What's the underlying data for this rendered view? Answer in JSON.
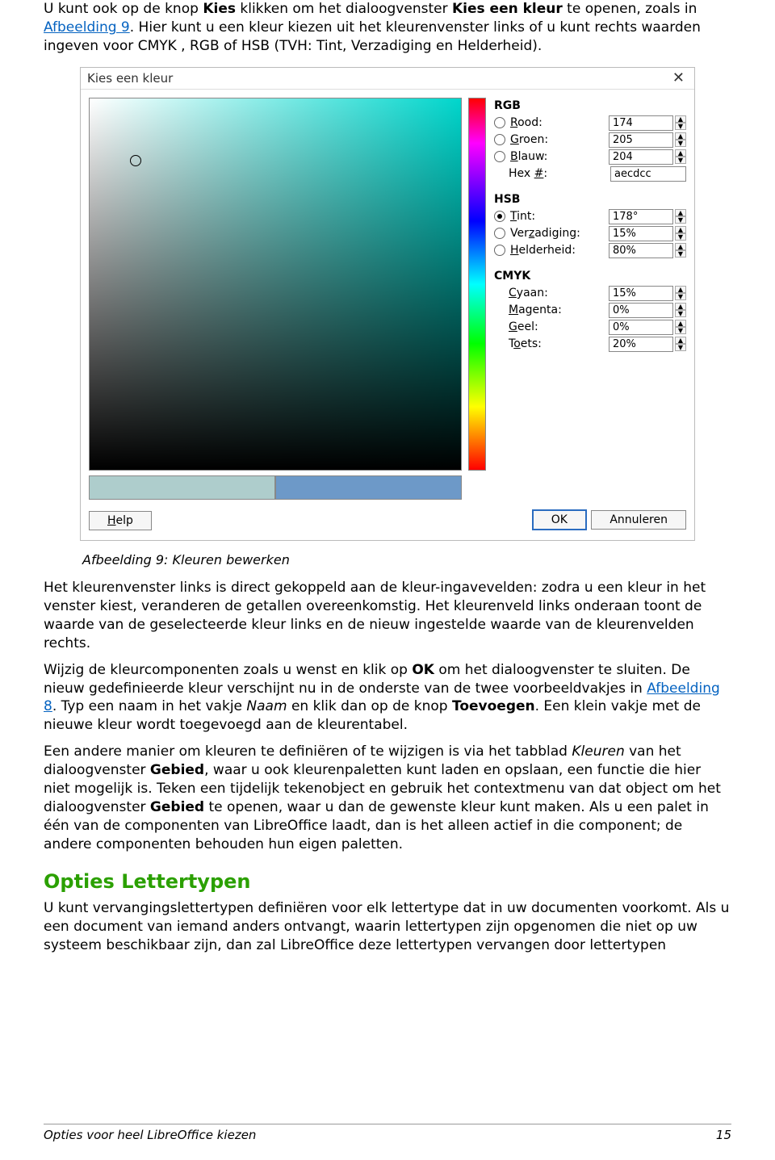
{
  "intro": {
    "t1a": "U kunt ook op de knop ",
    "t1b": "Kies",
    "t1c": " klikken om het dialoogvenster ",
    "t1d": "Kies een kleur",
    "t1e": " te openen, zoals in ",
    "link1": "Afbeelding 9",
    "t2": ". Hier kunt u een kleur kiezen uit het kleurenvenster links of u kunt rechts waarden ingeven voor CMYK , RGB of HSB (TVH: Tint, Verzadiging en Helderheid)."
  },
  "dialog": {
    "title": "Kies een kleur",
    "rgb_head": "RGB",
    "rood_u": "R",
    "rood_rest": "ood:",
    "rood_val": "174",
    "groen_u": "G",
    "groen_rest": "roen:",
    "groen_val": "205",
    "blauw_u": "B",
    "blauw_rest": "lauw:",
    "blauw_val": "204",
    "hex_label": "Hex ",
    "hex_u": "#",
    "hex_colon": ":",
    "hex_val": "aecdcc",
    "hsb_head": "HSB",
    "tint_u": "T",
    "tint_rest": "int:",
    "tint_val": "178°",
    "verz_pre": "Ver",
    "verz_u": "z",
    "verz_post": "adiging:",
    "verz_val": "15%",
    "held_u": "H",
    "held_rest": "elderheid:",
    "held_val": "80%",
    "cmyk_head": "CMYK",
    "cyaan_u": "C",
    "cyaan_rest": "yaan:",
    "cyaan_val": "15%",
    "mag_u": "M",
    "mag_rest": "agenta:",
    "mag_val": "0%",
    "geel_u": "G",
    "geel_rest": "eel:",
    "geel_val": "0%",
    "toets_pre": "T",
    "toets_u": "o",
    "toets_post": "ets:",
    "toets_val": "20%",
    "help_u": "H",
    "help_rest": "elp",
    "ok": "OK",
    "cancel": "Annuleren"
  },
  "caption": "Afbeelding 9: Kleuren bewerken",
  "p1": "Het  kleurenvenster links is direct gekoppeld aan de kleur-ingavevelden: zodra u een kleur in het venster kiest, veranderen de getallen overeenkomstig. Het kleurenveld links onderaan toont de waarde van de geselecteerde kleur links en de nieuw ingestelde waarde van de kleurenvelden rechts.",
  "p2a": "Wijzig de kleurcomponenten zoals u wenst en klik op ",
  "p2b": "OK",
  "p2c": " om het dialoogvenster te sluiten. De nieuw gedefinieerde kleur verschijnt nu in de onderste van de twee voorbeeldvakjes in ",
  "p2link": "Afbeelding 8",
  "p2d": ". Typ een naam in het vakje ",
  "p2e": "Naam",
  "p2f": " en klik dan op de knop ",
  "p2g": "Toevoegen",
  "p2h": ". Een klein vakje met de nieuwe kleur wordt toegevoegd aan de kleurentabel.",
  "p3a": "Een andere manier om kleuren te definiëren of te wijzigen is via het tabblad ",
  "p3b": "Kleuren",
  "p3c": " van het dialoogvenster ",
  "p3d": "Gebied",
  "p3e": ", waar u ook kleurenpaletten kunt laden en opslaan, een functie die hier niet mogelijk is. Teken een tijdelijk tekenobject en gebruik het contextmenu van dat object om het dialoogvenster ",
  "p3f": "Gebied",
  "p3g": " te openen, waar u dan de gewenste kleur kunt maken.  Als u een palet in één van de componenten van LibreOffice laadt, dan is het alleen actief in die component; de andere componenten behouden hun eigen paletten.",
  "h2": "Opties Lettertypen",
  "p4": "U kunt vervangingslettertypen definiëren voor elk lettertype dat in uw documenten voorkomt. Als u een document van iemand anders ontvangt, waarin lettertypen zijn opgenomen die niet op uw systeem beschikbaar zijn, dan zal LibreOffice deze lettertypen vervangen door lettertypen",
  "footer_left": "Opties voor heel LibreOffice kiezen",
  "footer_right": "15"
}
